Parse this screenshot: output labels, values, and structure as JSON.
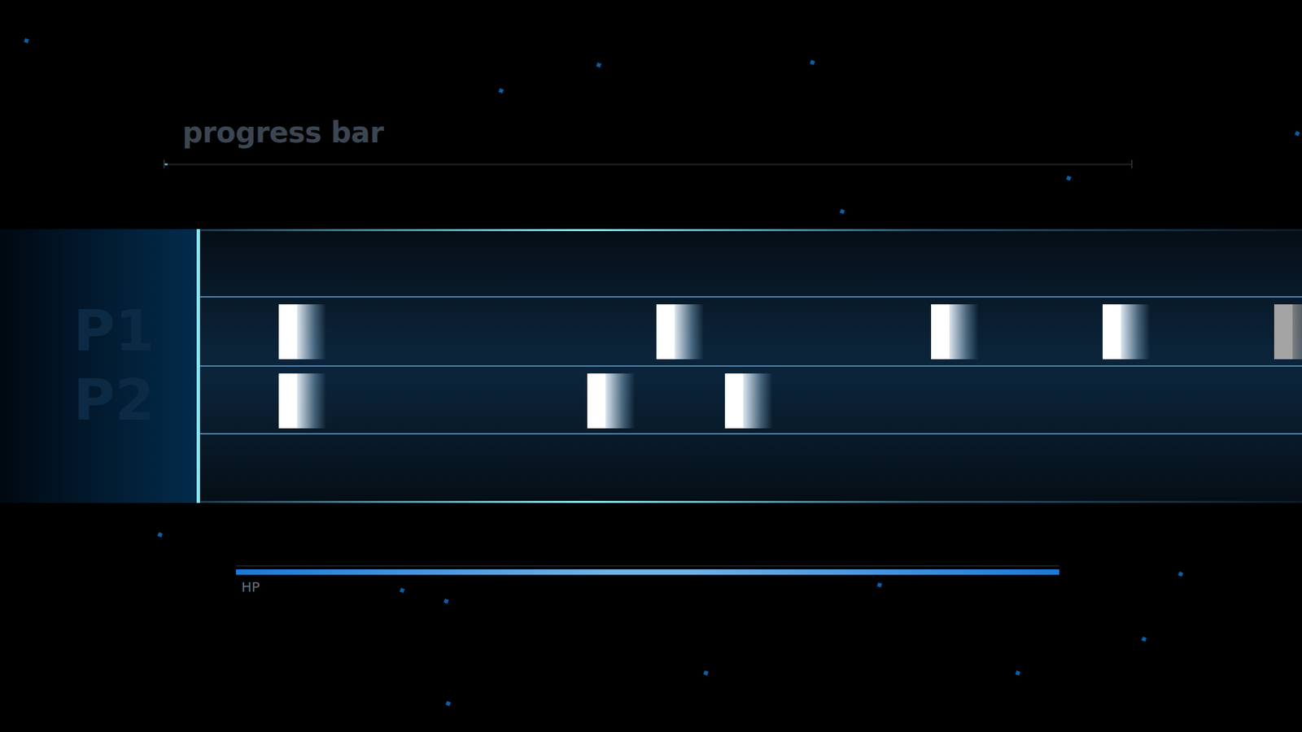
{
  "progress": {
    "label": "progress bar",
    "level": 0.003
  },
  "lanes": [
    {
      "label": "P1",
      "notes": [
        {
          "time": 116,
          "dimmed": false
        },
        {
          "time": 673,
          "dimmed": false
        },
        {
          "time": 1078,
          "dimmed": false
        },
        {
          "time": 1331,
          "dimmed": false
        },
        {
          "time": 1584,
          "dimmed": true
        }
      ]
    },
    {
      "label": "P2",
      "notes": [
        {
          "time": 116,
          "dimmed": false
        },
        {
          "time": 571,
          "dimmed": false
        },
        {
          "time": 774,
          "dimmed": false
        }
      ]
    }
  ],
  "hp": {
    "label": "HP",
    "level": 1
  }
}
